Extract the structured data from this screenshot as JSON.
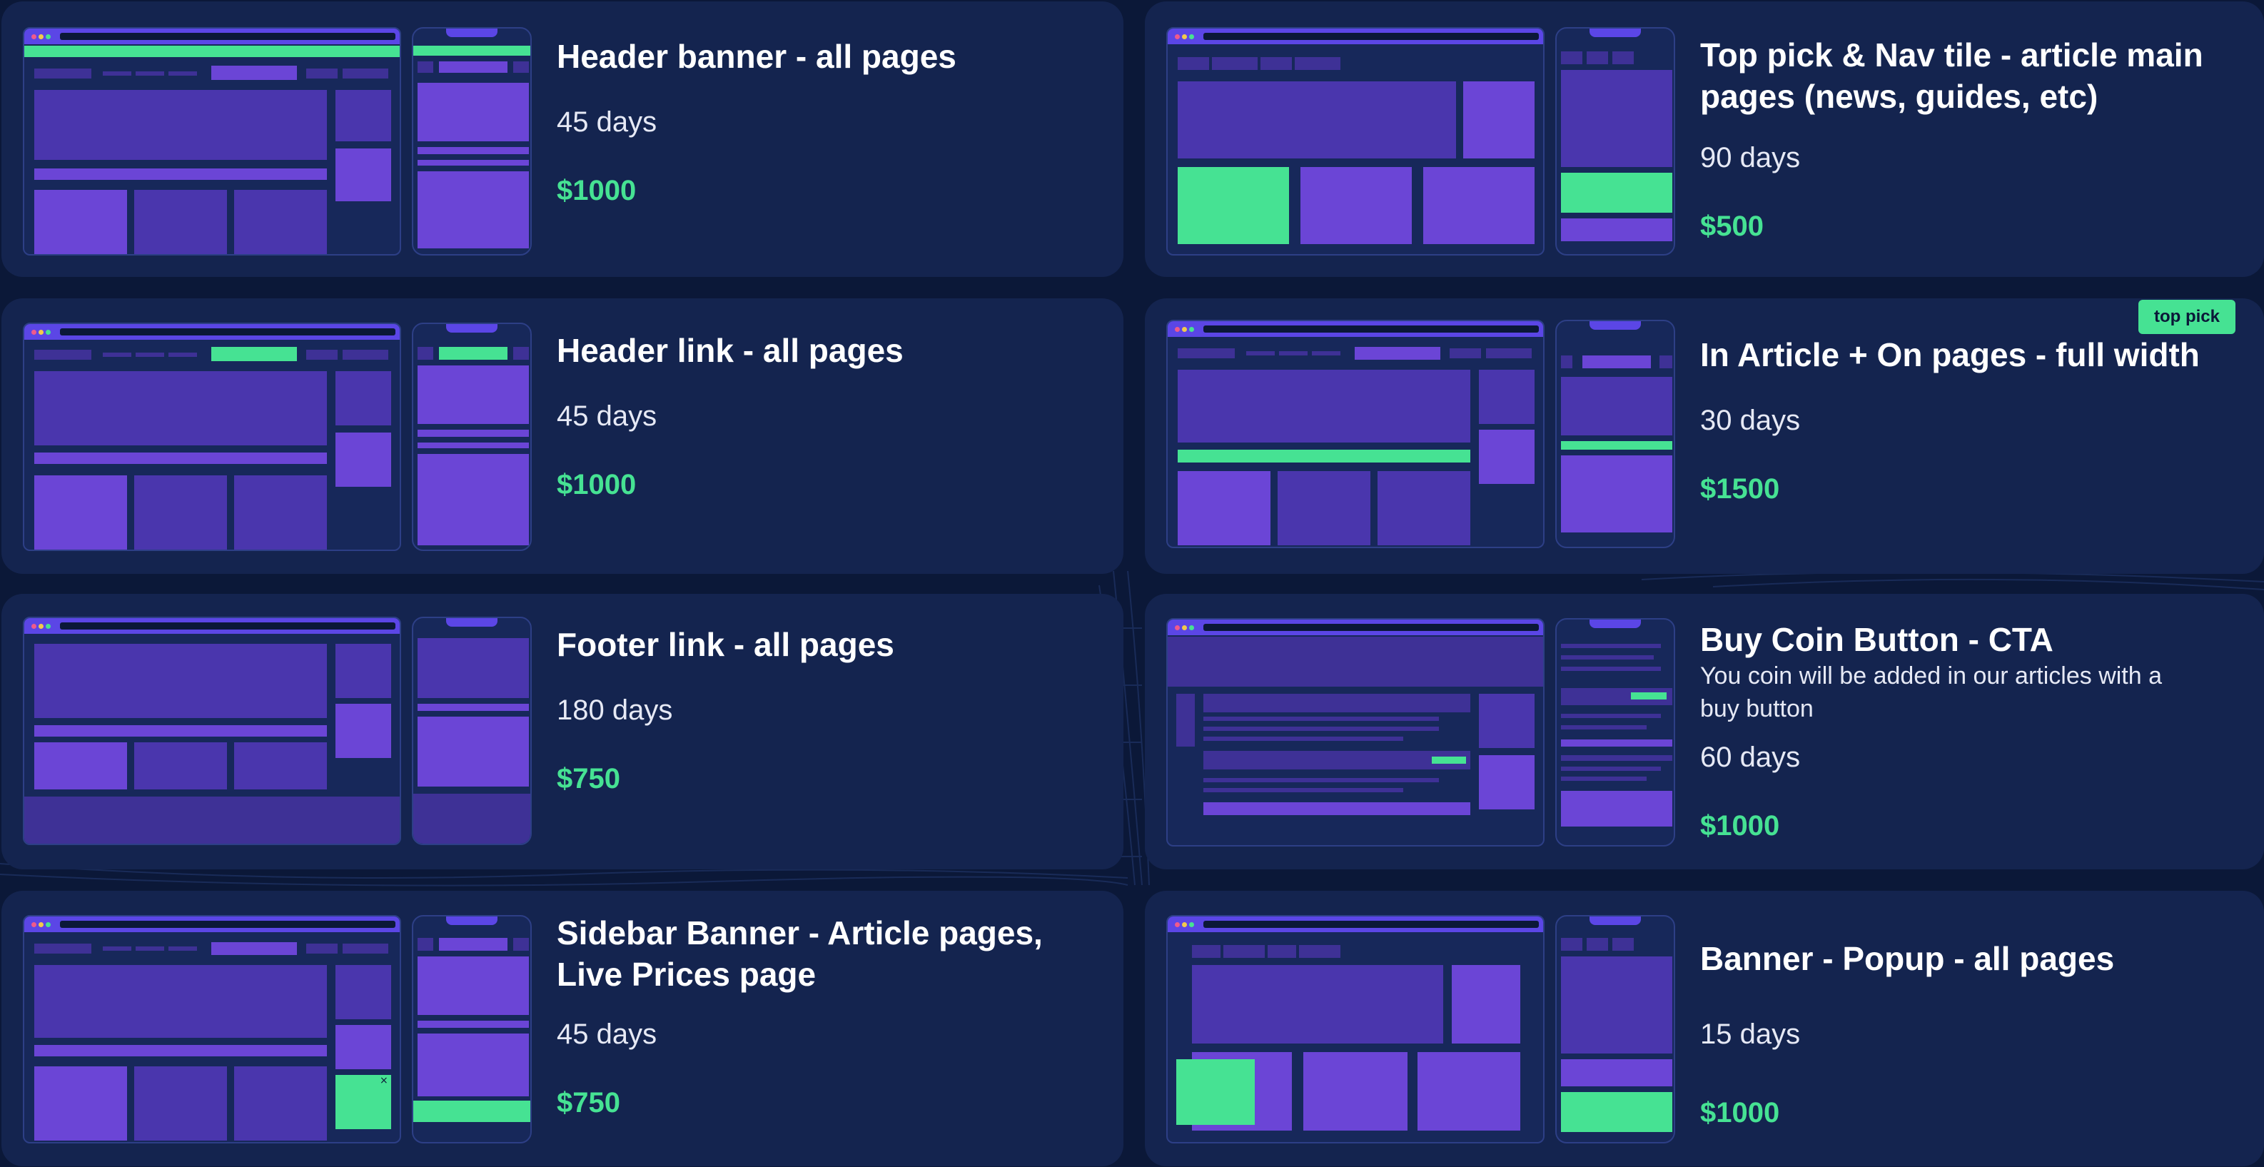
{
  "colors": {
    "background": "#0b1838",
    "card": "#14244f",
    "accent_green": "#46e293",
    "purple": "#6b45d6",
    "purple_dark": "#4a36ad",
    "blue_bar": "#5b46e6",
    "text": "#ffffff"
  },
  "cards": [
    {
      "title": "Header banner - all pages",
      "days": "45 days",
      "price": "$1000"
    },
    {
      "title": "Top pick & Nav tile - article main pages (news, guides, etc)",
      "days": "90 days",
      "price": "$500"
    },
    {
      "title": "Header link - all pages",
      "days": "45 days",
      "price": "$1000"
    },
    {
      "title": "In Article + On pages - full width",
      "days": "30 days",
      "price": "$1500",
      "badge": "top pick"
    },
    {
      "title": "Footer link - all pages",
      "days": "180 days",
      "price": "$750"
    },
    {
      "title": "Buy Coin Button - CTA",
      "subtitle": "You coin will be added in our articles with a buy button",
      "days": "60 days",
      "price": "$1000"
    },
    {
      "title": "Sidebar Banner - Article pages, Live Prices page",
      "days": "45 days",
      "price": "$750",
      "close_glyph": "×"
    },
    {
      "title": "Banner - Popup - all pages",
      "days": "15 days",
      "price": "$1000"
    }
  ]
}
